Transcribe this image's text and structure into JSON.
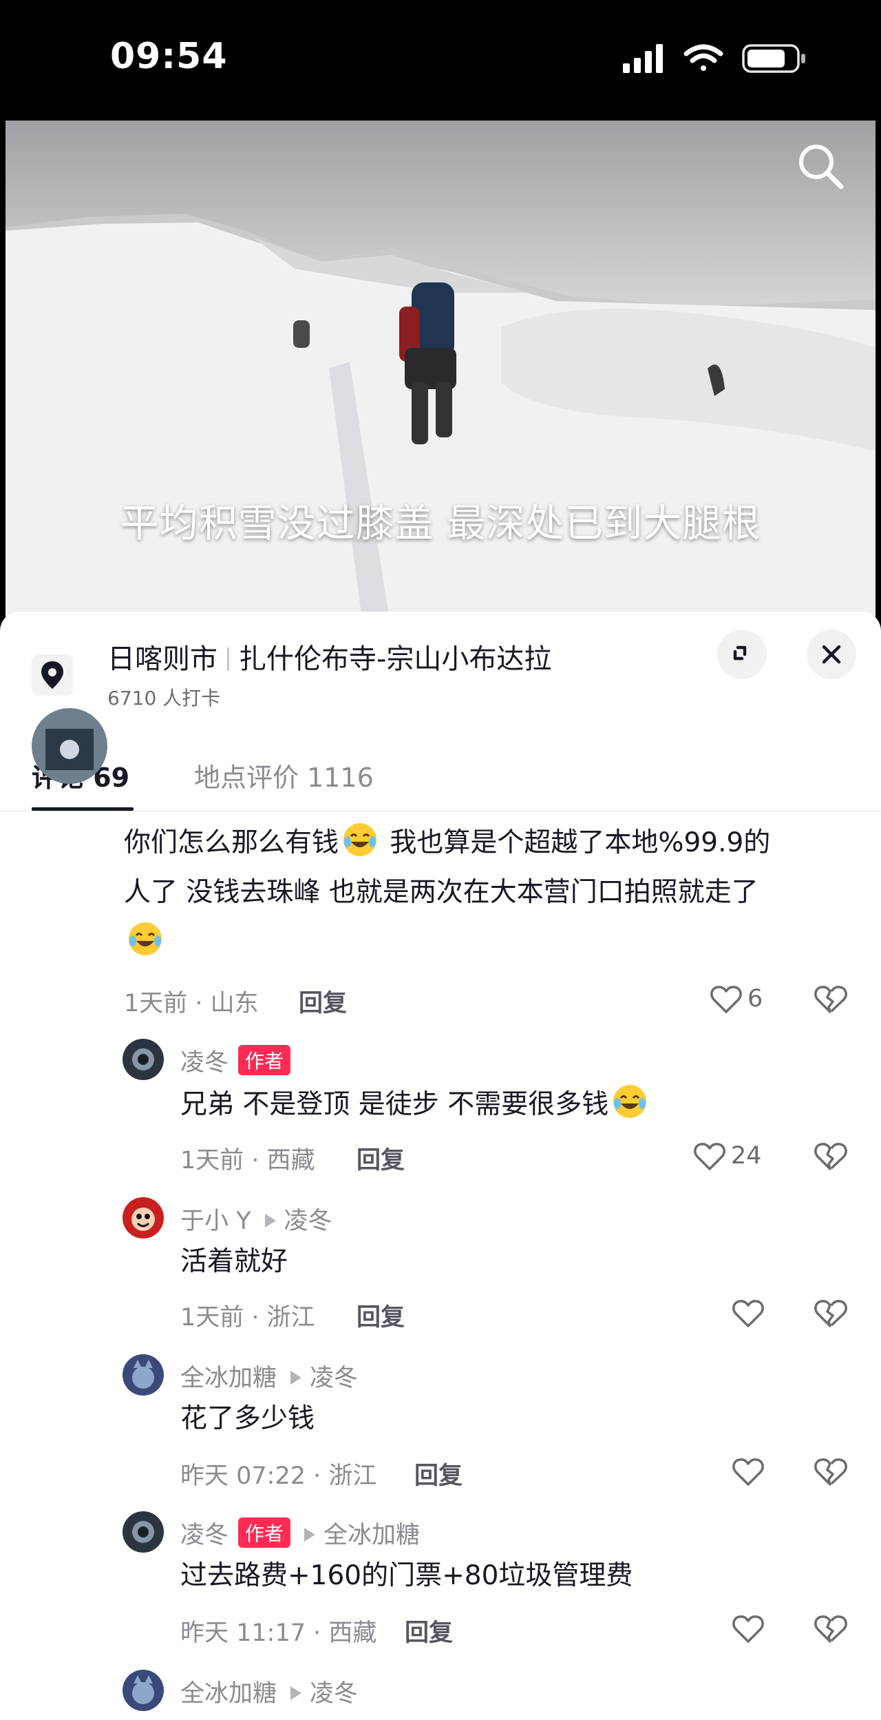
{
  "status_bar": {
    "time": "09:54"
  },
  "video": {
    "caption": "平均积雪没过膝盖 最深处已到大腿根"
  },
  "location": {
    "city": "日喀则市",
    "place": "扎什伦布寺-宗山小布达拉",
    "checkins": "6710 人打卡"
  },
  "tabs": {
    "comments": "评论 69",
    "reviews": "地点评价 1116"
  },
  "comments": [
    {
      "line1": "你们怎么那么有钱",
      "line1b": " 我也算是个超越了本地%99.9的",
      "line2": "人了 没钱去珠峰 也就是两次在大本营门口拍照就走了",
      "meta": "1天前 · 山东",
      "reply": "回复",
      "likes": "6"
    },
    {
      "user": "凌冬",
      "badge": "作者",
      "text": "兄弟 不是登顶 是徒步 不需要很多钱",
      "meta": "1天前 · 西藏",
      "reply": "回复",
      "likes": "24"
    },
    {
      "user": "于小 Y",
      "reply_to": "凌冬",
      "text": "活着就好",
      "meta": "1天前 · 浙江",
      "reply": "回复"
    },
    {
      "user": "全冰加糖",
      "reply_to": "凌冬",
      "text": "花了多少钱",
      "meta": "昨天 07:22 · 浙江",
      "reply": "回复"
    },
    {
      "user": "凌冬",
      "badge": "作者",
      "reply_to": "全冰加糖",
      "text": "过去路费+160的门票+80垃圾管理费",
      "meta": "昨天 11:17 · 西藏",
      "reply": "回复"
    },
    {
      "user": "全冰加糖",
      "reply_to": "凌冬"
    }
  ],
  "colors": {
    "accent": "#fe2c55",
    "text": "#161823",
    "muted": "#8a8b91"
  }
}
